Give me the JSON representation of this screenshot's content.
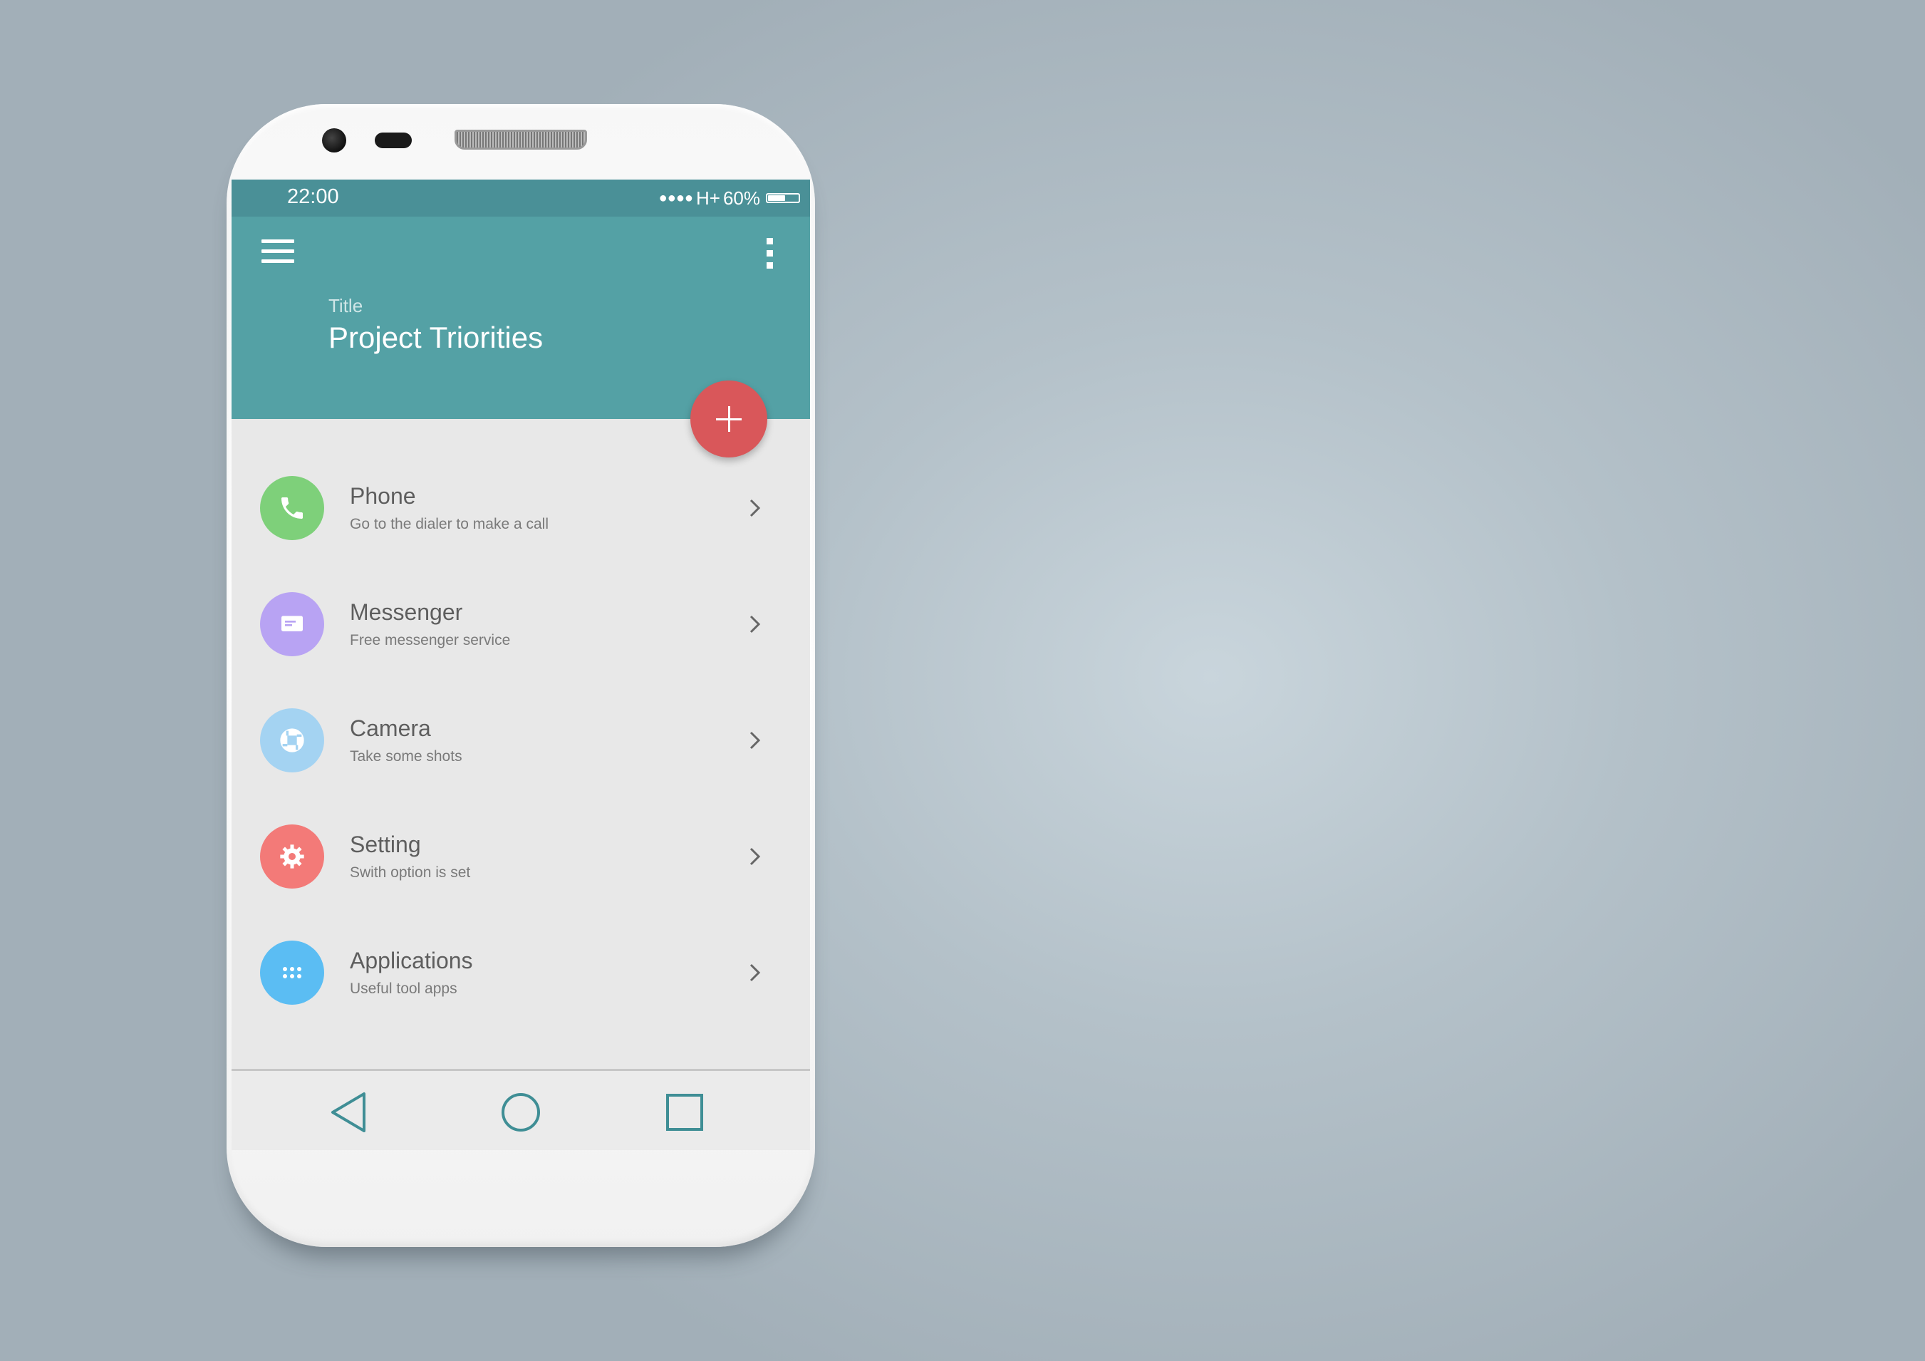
{
  "status_bar": {
    "time": "22:00",
    "signal": "●●●●",
    "network": "H+",
    "battery_text": "60%",
    "battery_level": 0.6
  },
  "app_bar": {
    "menu_icon": "hamburger-menu-icon",
    "more_icon": "more-vertical-icon",
    "title_label": "Title",
    "title": "Project Triorities"
  },
  "fab": {
    "icon": "plus-icon"
  },
  "items": [
    {
      "title": "Phone",
      "subtitle": "Go to the dialer to make a call",
      "icon": "phone-icon",
      "color": "#7ed07a"
    },
    {
      "title": "Messenger",
      "subtitle": "Free messenger service",
      "icon": "message-icon",
      "color": "#b8a3f3"
    },
    {
      "title": "Camera",
      "subtitle": "Take some shots",
      "icon": "camera-shutter-icon",
      "color": "#a4d3f2"
    },
    {
      "title": "Setting",
      "subtitle": "Swith option is set",
      "icon": "gear-icon",
      "color": "#f37a78"
    },
    {
      "title": "Applications",
      "subtitle": "Useful tool apps",
      "icon": "apps-grid-icon",
      "color": "#5bbdf3"
    }
  ],
  "nav": {
    "back_icon": "back-triangle-icon",
    "home_icon": "home-circle-icon",
    "recents_icon": "recents-square-icon",
    "color": "#3f8e95"
  }
}
